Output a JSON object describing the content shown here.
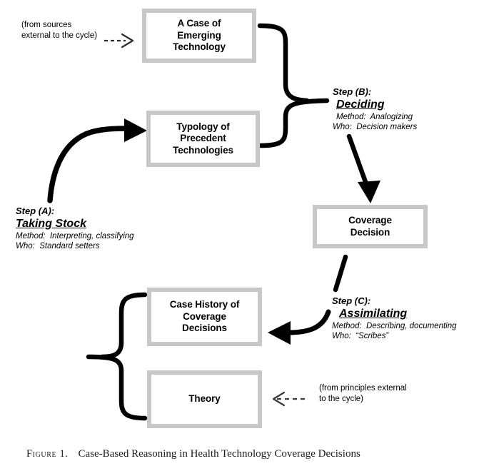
{
  "figure": {
    "caption_label": "Figure 1.",
    "caption_text": "Case-Based Reasoning in Health Technology Coverage Decisions"
  },
  "nodes": [
    {
      "id": "emerging-technology",
      "label": "A Case of\nEmerging\nTechnology"
    },
    {
      "id": "typology",
      "label": "Typology of\nPrecedent\nTechnologies"
    },
    {
      "id": "coverage-decision",
      "label": "Coverage\nDecision"
    },
    {
      "id": "case-history",
      "label": "Case History of\nCoverage\nDecisions"
    },
    {
      "id": "theory",
      "label": "Theory"
    }
  ],
  "steps": [
    {
      "id": "a",
      "head": "Step (A):",
      "name": "Taking Stock",
      "method": "Method:  Interpreting, classifying",
      "who": "Who:  Standard setters"
    },
    {
      "id": "b",
      "head": "Step (B):",
      "name": "Deciding",
      "method": "Method:  Analogizing",
      "who": "Who:  Decision makers"
    },
    {
      "id": "c",
      "head": "Step (C):",
      "name": "Assimilating",
      "method": "Method:  Describing, documenting",
      "who": "Who:  “Scribes”"
    }
  ],
  "notes": {
    "sources": "(from sources\nexternal to the cycle)",
    "principles": "(from principles external\nto the cycle)"
  },
  "colors": {
    "box_border": "#c8c8c8",
    "box_fill": "#ffffff",
    "connector": "#000000",
    "text": "#000000",
    "dashed_connector": "#3a3a3a"
  },
  "icons": {
    "dashed_arrow_in": "dashed-arrow-right-icon",
    "dashed_arrow_theory": "dashed-arrow-left-icon",
    "brace_right": "brace-right-icon",
    "brace_left": "brace-left-icon",
    "arrow_down": "arrow-down-icon",
    "arrow_left_curved": "arrow-left-curved-icon",
    "arrow_up_curved": "arrow-up-curved-icon"
  }
}
